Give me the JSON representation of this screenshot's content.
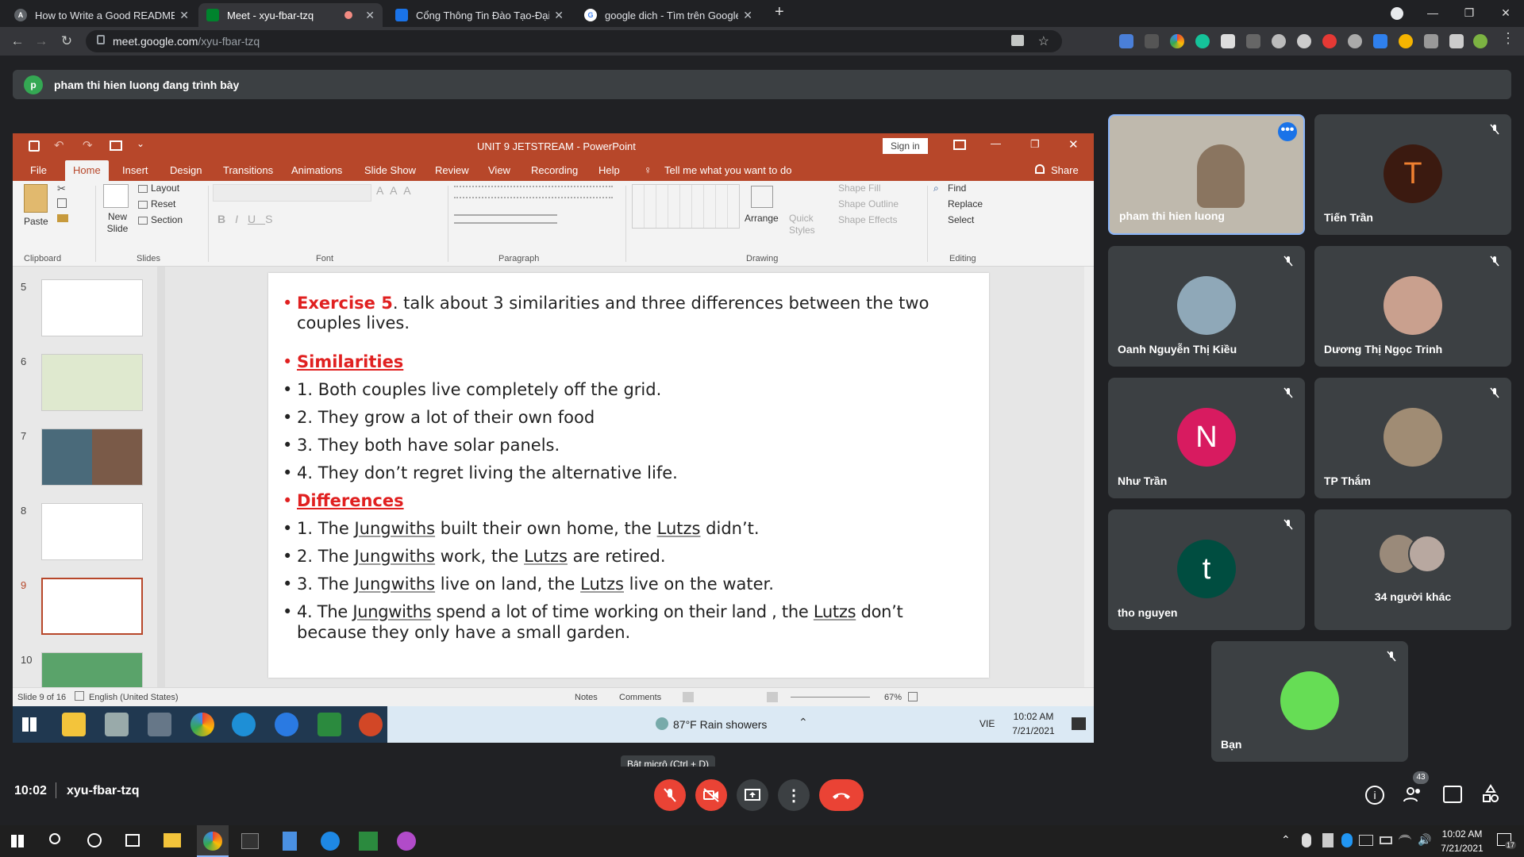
{
  "browser": {
    "tabs": [
      {
        "title": "How to Write a Good README Fi",
        "icon": "github-icon",
        "color": "#5f6368"
      },
      {
        "title": "Meet - xyu-fbar-tzq",
        "icon": "meet-icon",
        "color": "#00832d"
      },
      {
        "title": "Cổng Thông Tin Đào Tạo-Đại họ",
        "icon": "school-icon",
        "color": "#1a73e8"
      },
      {
        "title": "google dich - Tìm trên Google",
        "icon": "google-icon",
        "color": "#4285f4"
      }
    ],
    "url_host": "meet.google.com",
    "url_path": "/xyu-fbar-tzq"
  },
  "meet": {
    "presenting_text": "pham thi hien luong đang trình bày",
    "presenter_initial": "p",
    "meeting_code": "xyu-fbar-tzq",
    "time": "10:02",
    "mic_tooltip": "Bật micrô (Ctrl + D)",
    "participants_count": "43",
    "participants": [
      {
        "name": "pham thi hien luong",
        "initial": "",
        "color": "#8a7a6a",
        "muted": false
      },
      {
        "name": "Tiến Trần",
        "initial": "T",
        "color": "#3b1a10",
        "muted": true
      },
      {
        "name": "Oanh Nguyễn Thị Kiều",
        "initial": "",
        "color": "#8fa8b8",
        "muted": true
      },
      {
        "name": "Dương Thị Ngọc Trinh",
        "initial": "",
        "color": "#c9a08e",
        "muted": true
      },
      {
        "name": "Như Trần",
        "initial": "N",
        "color": "#d81b60",
        "muted": true
      },
      {
        "name": "TP Thắm",
        "initial": "",
        "color": "#a08c74",
        "muted": true
      },
      {
        "name": "tho nguyen",
        "initial": "t",
        "color": "#004d40",
        "muted": true
      },
      {
        "name": "34 người khác",
        "initial": "",
        "color": "#6d6d6d",
        "muted": false
      },
      {
        "name": "Bạn",
        "initial": "",
        "color": "#66dd55",
        "muted": true
      }
    ]
  },
  "ppt": {
    "title": "UNIT 9 JETSTREAM  -  PowerPoint",
    "signin": "Sign in",
    "share": "Share",
    "tellme": "Tell me what you want to do",
    "tabs": [
      "File",
      "Home",
      "Insert",
      "Design",
      "Transitions",
      "Animations",
      "Slide Show",
      "Review",
      "View",
      "Recording",
      "Help"
    ],
    "groups": {
      "clipboard": "Clipboard",
      "slides": "Slides",
      "font": "Font",
      "paragraph": "Paragraph",
      "drawing": "Drawing",
      "editing": "Editing"
    },
    "buttons": {
      "paste": "Paste",
      "new_slide": "New Slide",
      "layout": "Layout",
      "reset": "Reset",
      "section": "Section",
      "arrange": "Arrange",
      "quick_styles": "Quick Styles",
      "shape_fill": "Shape Fill",
      "shape_outline": "Shape Outline",
      "shape_effects": "Shape Effects",
      "find": "Find",
      "replace": "Replace",
      "select": "Select"
    },
    "thumbnails": [
      "5",
      "6",
      "7",
      "8",
      "9",
      "10"
    ],
    "status": {
      "slide": "Slide 9 of 16",
      "lang": "English (United States)",
      "notes": "Notes",
      "comments": "Comments",
      "zoom": "67%"
    },
    "slide": {
      "ex_label": "Exercise 5",
      "ex_text": ". talk about 3 similarities and three differences between the two",
      "ex_text2": "couples lives.",
      "sim": "Similarities",
      "s1": "1. Both couples live completely off the grid.",
      "s2": "2. They grow a lot of their own food",
      "s3": "3. They both have solar panels.",
      "s4": "4. They don’t regret living the alternative life.",
      "diff": "Differences",
      "d1a": "1. The ",
      "d1b": "Jungwiths",
      "d1c": " built their own home, the ",
      "d1d": "Lutzs",
      "d1e": " didn’t.",
      "d2a": "2. The ",
      "d2b": "Jungwiths",
      "d2c": " work, the ",
      "d2d": "Lutzs",
      "d2e": " are retired.",
      "d3a": "3. The ",
      "d3b": "Jungwiths",
      "d3c": " live on land, the ",
      "d3d": "Lutzs",
      "d3e": " live on the water.",
      "d4a": "4. The ",
      "d4b": "Jungwiths",
      "d4c": " spend a lot of time working on their land , the ",
      "d4d": "Lutzs",
      "d4e": " don’t",
      "d4f": "because they only have a small garden."
    }
  },
  "remote_taskbar": {
    "weather": "87°F  Rain showers",
    "lang": "VIE",
    "time": "10:02 AM",
    "date": "7/21/2021"
  },
  "local_taskbar": {
    "time": "10:02 AM",
    "date": "7/21/2021",
    "notif": "17"
  }
}
